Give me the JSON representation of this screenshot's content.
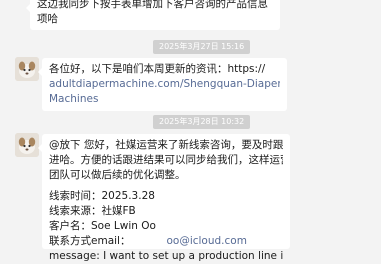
{
  "messages": [
    {
      "lines": [
        "这边我同步下按手表单增加下客户咨询的产品信息",
        "项哈"
      ]
    },
    {
      "timestamp": "2025年3月27日 15:16",
      "line1": "各位好，以下是咱们本周更新的资讯：https://",
      "link_lines": [
        "adultdiapermachine.com/Shengquan-Diaper-",
        "Machines"
      ]
    },
    {
      "timestamp": "2025年3月28日 10:32",
      "intro": [
        "@放下 您好，社媒运营来了新线索咨询，要及时跟",
        "进哈。方便的话跟进结果可以同步给我们，这样运营",
        "团队可以做后续的优化调整。"
      ],
      "fields": [
        "线索时间：2025.3.28",
        "线索来源：社媒FB",
        "客户名：Soe Lwin Oo",
        "联系方式email：",
        "message: I want to set up a production line in"
      ],
      "email": "oo@icloud.com"
    }
  ]
}
